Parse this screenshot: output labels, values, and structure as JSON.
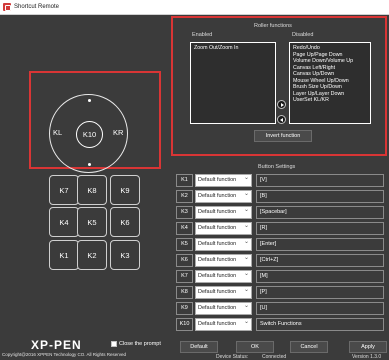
{
  "window": {
    "title": "Shortcut Remote"
  },
  "device": {
    "wheel": {
      "left": "KL",
      "center": "K10",
      "right": "KR"
    },
    "keys": [
      "K7",
      "K8",
      "K9",
      "K4",
      "K5",
      "K6",
      "K1",
      "K2",
      "K3"
    ]
  },
  "roller": {
    "title": "Roller functions",
    "enabled_label": "Enabled",
    "disabled_label": "Disabled",
    "enabled_items": [
      "Zoom Out/Zoom In"
    ],
    "disabled_items": [
      "Redo/Undo",
      "Page Up/Page Down",
      "Volume Down/Volume Up",
      "Canvas Left/Right",
      "Canvas Up/Down",
      "Mouse Wheel Up/Down",
      "Brush Size Up/Down",
      "Layer Up/Layer Down",
      "UserSet KL/KR"
    ],
    "invert_label": "Invert function"
  },
  "button_settings": {
    "title": "Button Settings",
    "rows": [
      {
        "key": "K1",
        "func": "Default function",
        "value": "[V]"
      },
      {
        "key": "K2",
        "func": "Default function",
        "value": "[B]"
      },
      {
        "key": "K3",
        "func": "Default function",
        "value": "[Spacebar]"
      },
      {
        "key": "K4",
        "func": "Default function",
        "value": "[R]"
      },
      {
        "key": "K5",
        "func": "Default function",
        "value": "[Enter]"
      },
      {
        "key": "K6",
        "func": "Default function",
        "value": "[Ctrl+Z]"
      },
      {
        "key": "K7",
        "func": "Default function",
        "value": "[M]"
      },
      {
        "key": "K8",
        "func": "Default function",
        "value": "[P]"
      },
      {
        "key": "K9",
        "func": "Default function",
        "value": "[U]"
      },
      {
        "key": "K10",
        "func": "Default function",
        "value": "Switch Functions"
      }
    ]
  },
  "footer": {
    "logo": "XP-PEN",
    "close_prompt": "Close the prompt",
    "default_label": "Default",
    "ok_label": "OK",
    "cancel_label": "Cancel",
    "apply_label": "Apply",
    "copyright": "Copyright@2016  XPPEN Technology CO. All Rights Reserved",
    "status_label": "Device Status:",
    "status_value": "Connected",
    "version": "Version 1.3.0"
  },
  "colors": {
    "highlight": "#d93535",
    "background": "#3b3b3b"
  }
}
